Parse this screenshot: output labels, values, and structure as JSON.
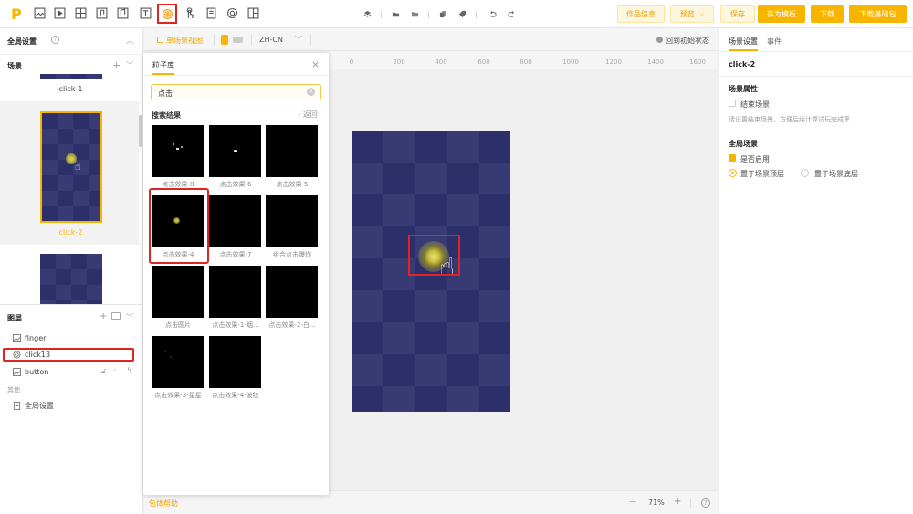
{
  "toolbar": {
    "logo": "P",
    "buttons": {
      "info": "作品信息",
      "preview": "预览",
      "save": "保存",
      "save_template": "存为模板",
      "download": "下载",
      "download_base": "下载基础包"
    }
  },
  "left": {
    "global_settings": "全局设置",
    "scene_title": "场景",
    "scenes": [
      {
        "label": "click-1"
      },
      {
        "label": "click-2"
      }
    ],
    "layers_title": "图层",
    "layers": [
      {
        "label": "finger"
      },
      {
        "label": "click13"
      },
      {
        "label": "button"
      }
    ],
    "other_title": "其他",
    "other_items": [
      {
        "label": "全局设置"
      }
    ]
  },
  "canvas": {
    "view_mode": "单场景视图",
    "language": "ZH-CN",
    "reset_label": "回到初始状态",
    "ruler_ticks": [
      "0",
      "200",
      "400",
      "600",
      "800",
      "1000",
      "1200",
      "1400",
      "1600"
    ],
    "help_label": "包体帮助",
    "zoom": "71%",
    "zoom_minus": "—",
    "zoom_plus": "+"
  },
  "particle_library": {
    "title": "粒子库",
    "search_value": "点击",
    "results_title": "搜索结果",
    "back_label": "返回",
    "items": [
      {
        "label": "点击效果-8"
      },
      {
        "label": "点击效果-6"
      },
      {
        "label": "点击效果-5"
      },
      {
        "label": "点击效果-4"
      },
      {
        "label": "点击效果-7"
      },
      {
        "label": "组合点击爆炸"
      },
      {
        "label": "点击圆片"
      },
      {
        "label": "点击效果-1-烟..."
      },
      {
        "label": "点击效果-2-白..."
      },
      {
        "label": "点击效果-3-星星"
      },
      {
        "label": "点击效果-4-波纹"
      }
    ]
  },
  "right": {
    "tabs": [
      "场景设置",
      "事件"
    ],
    "scene_name": "click-2",
    "scene_props_title": "场景属性",
    "end_scene_label": "结束场景",
    "end_scene_hint": "请设置结束场景，方便后续计算试玩完成率",
    "global_scene_title": "全局场景",
    "enable_label": "是否启用",
    "place_top": "置于场景顶层",
    "place_bottom": "置于场景底层"
  },
  "colors": {
    "accent": "#f8b500",
    "highlight_red": "#e02424",
    "scene_bg": "#2d2f6b"
  }
}
